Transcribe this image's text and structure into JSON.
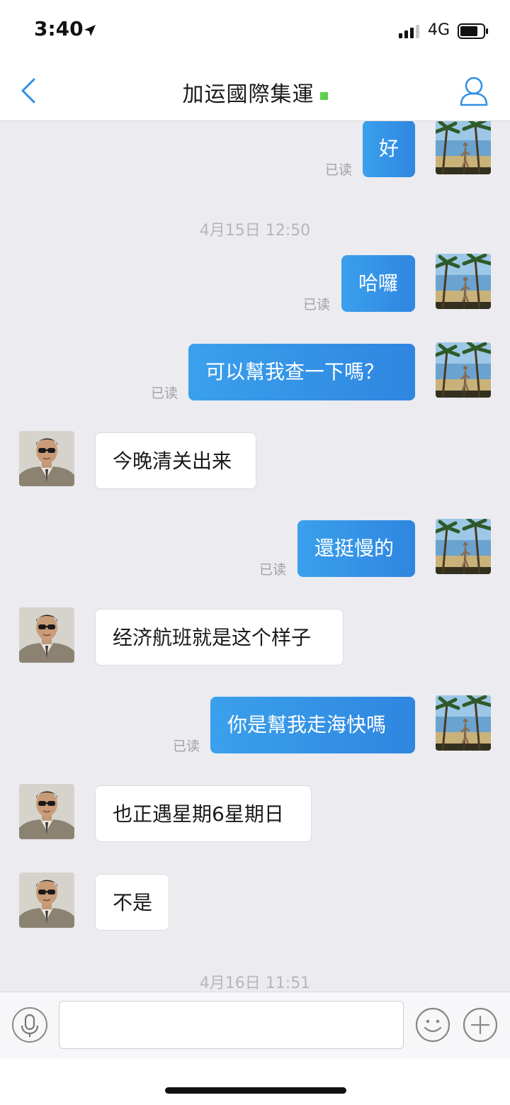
{
  "status_bar": {
    "time": "3:40",
    "network": "4G"
  },
  "header": {
    "title": "加运國際集運"
  },
  "messages": [
    {
      "type": "outgoing",
      "text": "好",
      "read": "已读"
    },
    {
      "type": "timestamp",
      "text": "4月15日 12:50"
    },
    {
      "type": "outgoing",
      "text": "哈囉",
      "read": "已读"
    },
    {
      "type": "outgoing",
      "text": "可以幫我查一下嗎？",
      "read": "已读"
    },
    {
      "type": "incoming",
      "text": "今晚清关出来"
    },
    {
      "type": "outgoing",
      "text": "還挺慢的",
      "read": "已读"
    },
    {
      "type": "incoming",
      "text": "经济航班就是这个样子"
    },
    {
      "type": "outgoing",
      "text": "你是幫我走海快嗎",
      "read": "已读"
    },
    {
      "type": "incoming",
      "text": "也正遇星期6星期日"
    },
    {
      "type": "incoming",
      "text": "不是"
    },
    {
      "type": "timestamp",
      "text": "4月16日 11:51"
    }
  ],
  "input": {
    "value": "",
    "placeholder": ""
  },
  "icons": {
    "back": "chevron-left-icon",
    "profile": "user-profile-icon",
    "mic": "microphone-icon",
    "emoji": "smiley-icon",
    "plus": "plus-icon",
    "online": "online-status-dot"
  },
  "colors": {
    "accent": "#2f86e0",
    "online": "#5cd14c",
    "background": "#ebebf0"
  }
}
